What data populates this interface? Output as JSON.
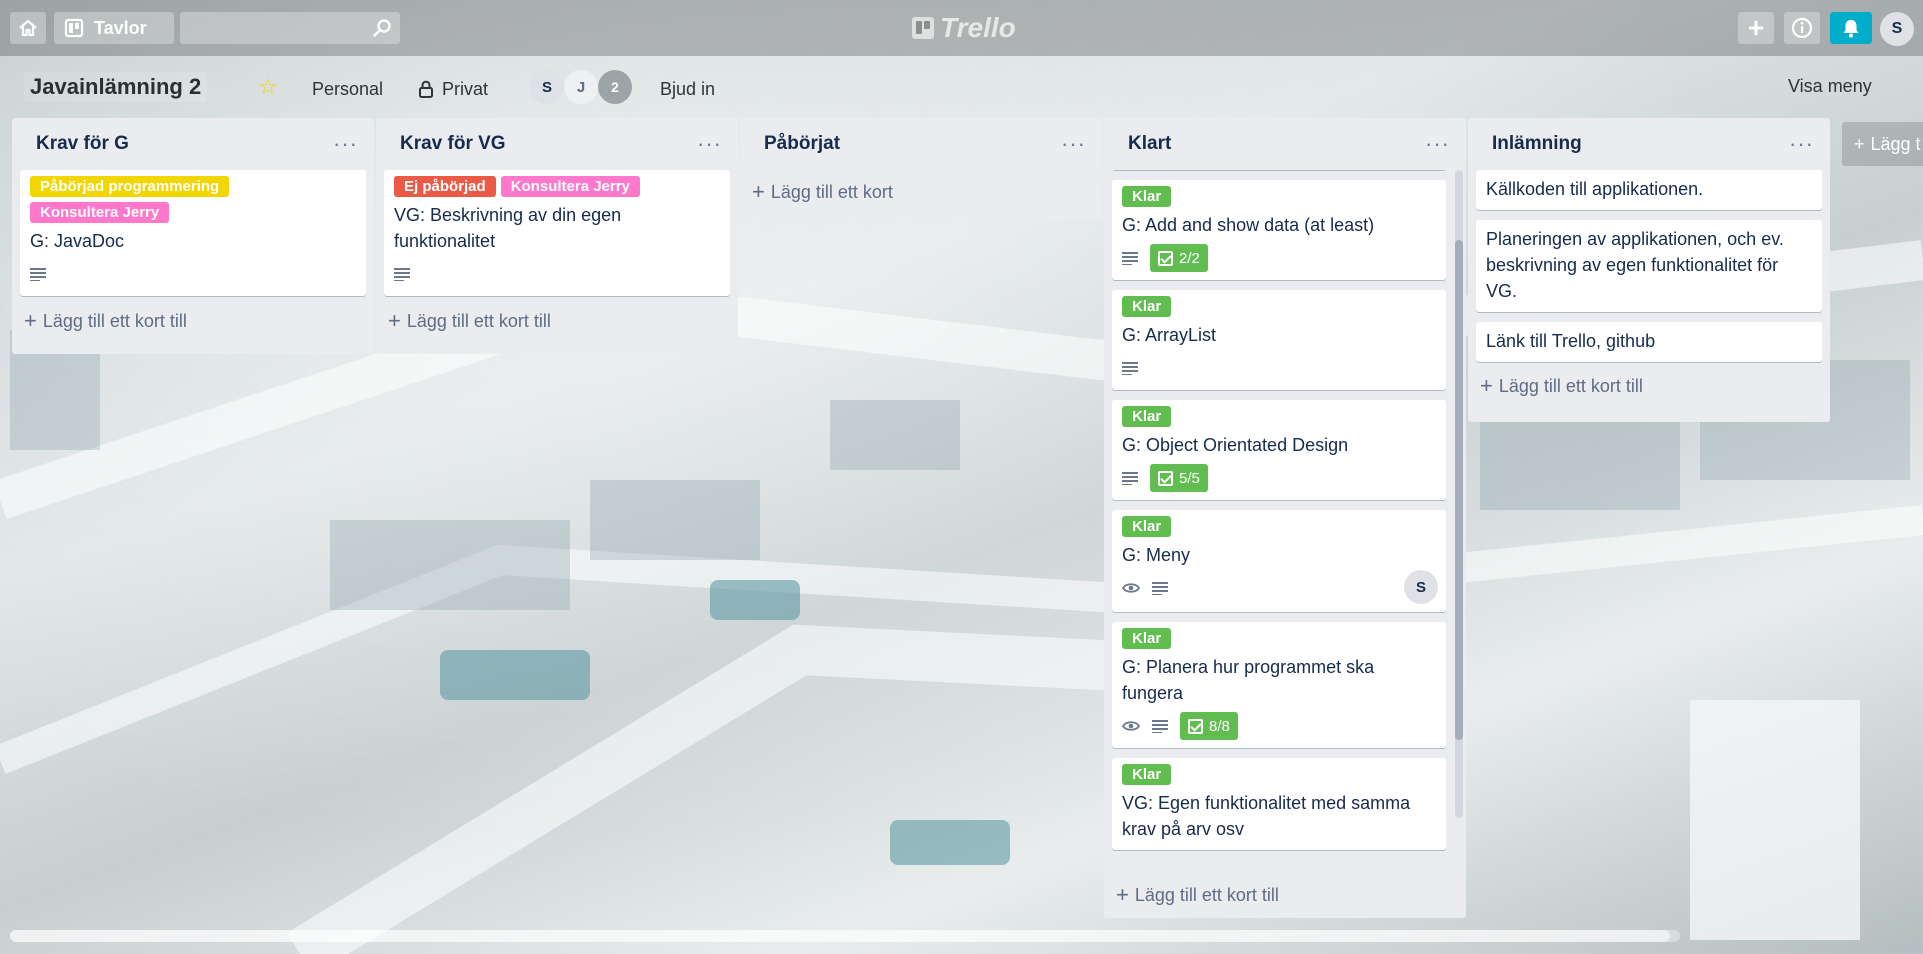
{
  "header": {
    "boards_label": "Tavlor",
    "logo_text": "Trello",
    "add_label": "+",
    "user_initial": "S",
    "icons": [
      "home-icon",
      "board-icon",
      "search-icon",
      "plus-icon",
      "info-icon",
      "bell-icon"
    ],
    "notify_color": "#00aecc"
  },
  "board": {
    "title": "Javainlämning 2",
    "visibility_team": "Personal",
    "visibility_privacy": "Privat",
    "members": [
      "S",
      "J"
    ],
    "member_count": "2",
    "invite_label": "Bjud in",
    "menu_label": "Visa meny"
  },
  "lists": [
    {
      "title": "Krav för G",
      "add_label": "Lägg till ett kort till",
      "cards": [
        {
          "labels": [
            {
              "text": "Påbörjad programmering",
              "color": "#f2d600"
            },
            {
              "text": "Konsultera Jerry",
              "color": "#ff78cb"
            }
          ],
          "title": "G: JavaDoc"
        }
      ]
    },
    {
      "title": "Krav för VG",
      "add_label": "Lägg till ett kort till",
      "cards": [
        {
          "labels": [
            {
              "text": "Ej påbörjad",
              "color": "#eb5a46"
            },
            {
              "text": "Konsultera Jerry",
              "color": "#ff78cb"
            }
          ],
          "title": "VG: Beskrivning av din egen funktionalitet"
        }
      ]
    },
    {
      "title": "Påbörjat",
      "add_label": "Lägg till ett kort"
    },
    {
      "title": "Klart",
      "add_label": "Lägg till ett kort till",
      "cards": [
        {
          "label": "Klar",
          "title": "G: Add and show data (at least)",
          "checklist": "2/2"
        },
        {
          "label": "Klar",
          "title": "G: ArrayList"
        },
        {
          "label": "Klar",
          "title": "G: Object Orientated Design",
          "checklist": "5/5"
        },
        {
          "label": "Klar",
          "title": "G: Meny",
          "member": "S"
        },
        {
          "label": "Klar",
          "title": "G: Planera hur programmet ska fungera",
          "checklist": "8/8"
        },
        {
          "label": "Klar",
          "title": "VG: Egen funktionalitet med samma krav på arv osv"
        }
      ]
    },
    {
      "title": "Inlämning",
      "add_label": "Lägg till ett kort till",
      "cards": [
        {
          "title": "Källkoden till applikationen."
        },
        {
          "title": "Planeringen av applikationen, och ev. beskrivning av egen funktionalitet för VG."
        },
        {
          "title": "Länk till Trello, github"
        }
      ]
    }
  ],
  "add_list_label": "Lägg t",
  "colors": {
    "label_green": "#61bd4f",
    "label_yellow": "#f2d600",
    "label_pink": "#ff78cb",
    "label_red": "#eb5a46"
  }
}
